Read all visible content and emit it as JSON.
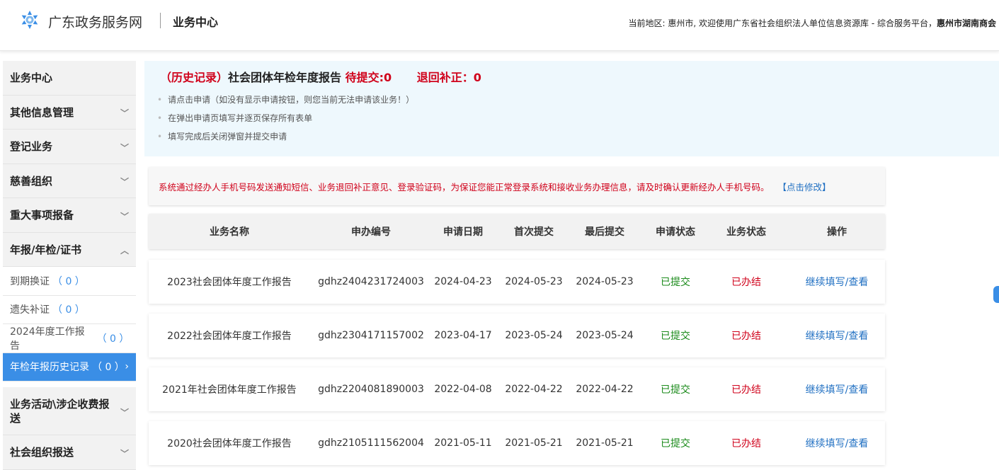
{
  "header": {
    "site_name": "广东政务服务网",
    "center_title": "业务中心",
    "region_prefix": "当前地区: 惠州市, 欢迎使用广东省社会组织法人单位信息资源库 - 综合服务平台，",
    "region_org": "惠州市湖南商会"
  },
  "sidebar": {
    "items": [
      {
        "label": "业务中心"
      },
      {
        "label": "其他信息管理"
      },
      {
        "label": "登记业务"
      },
      {
        "label": "慈善组织"
      },
      {
        "label": "重大事项报备"
      },
      {
        "label": "年报/年检/证书"
      }
    ],
    "sub_items": [
      {
        "label": "到期换证",
        "count": "（ 0 ）"
      },
      {
        "label": "遗失补证",
        "count": "（ 0 ）"
      },
      {
        "label": "2024年度工作报告",
        "count": "（ 0 ）"
      },
      {
        "label": "年检年报历史记录",
        "count": "（ 0 ）"
      }
    ],
    "more_items": [
      {
        "label": "业务活动\\涉企收费报送"
      },
      {
        "label": "社会组织报送"
      }
    ]
  },
  "info": {
    "history": "（历史记录）",
    "title": "社会团体年检年度报告",
    "pending": "待提交:0",
    "returned": "退回补正：0",
    "tips": [
      "请点击申请（如没有显示申请按钮，则您当前无法申请该业务！）",
      "在弹出申请页填写并逐页保存所有表单",
      "填写完成后关闭弹窗并提交申请"
    ]
  },
  "notice": {
    "text": "系统通过经办人手机号码发送通知短信、业务退回补正意见、登录验证码，为保证您能正常登录系统和接收业务办理信息，请及时确认更新经办人手机号码。",
    "link": "【点击修改】"
  },
  "table": {
    "headers": [
      "业务名称",
      "申办编号",
      "申请日期",
      "首次提交",
      "最后提交",
      "申请状态",
      "业务状态",
      "操作"
    ],
    "rows": [
      [
        "2023社会团体年度工作报告",
        "gdhz2404231724003",
        "2024-04-23",
        "2024-05-23",
        "2024-05-23",
        "已提交",
        "已办结",
        "继续填写/查看"
      ],
      [
        "2022社会团体年度工作报告",
        "gdhz2304171157002",
        "2023-04-17",
        "2023-05-24",
        "2023-05-24",
        "已提交",
        "已办结",
        "继续填写/查看"
      ],
      [
        "2021年社会团体年度工作报告",
        "gdhz2204081890003",
        "2022-04-08",
        "2022-04-22",
        "2022-04-22",
        "已提交",
        "已办结",
        "继续填写/查看"
      ],
      [
        "2020社会团体年度工作报告",
        "gdhz2105111562004",
        "2021-05-11",
        "2021-05-21",
        "2021-05-21",
        "已提交",
        "已办结",
        "继续填写/查看"
      ]
    ]
  },
  "colors": {
    "accent": "#3a8ee6",
    "alert": "#d0021b",
    "ok": "#1a8a1a",
    "link": "#1f6fc2"
  }
}
